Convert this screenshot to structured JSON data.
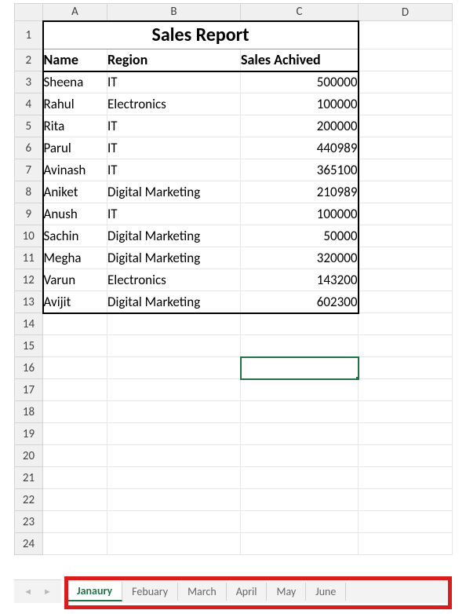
{
  "title": "Sales Report",
  "columns": [
    "A",
    "B",
    "C",
    "D"
  ],
  "headers": {
    "name": "Name",
    "region": "Region",
    "sales": "Sales Achived"
  },
  "rows": [
    {
      "name": "Sheena",
      "region": "IT",
      "sales": "500000"
    },
    {
      "name": "Rahul",
      "region": "Electronics",
      "sales": "100000"
    },
    {
      "name": "Rita",
      "region": "IT",
      "sales": "200000"
    },
    {
      "name": "Parul",
      "region": "IT",
      "sales": "440989"
    },
    {
      "name": "Avinash",
      "region": "IT",
      "sales": "365100"
    },
    {
      "name": "Aniket",
      "region": "Digital Marketing",
      "sales": "210989"
    },
    {
      "name": "Anush",
      "region": "IT",
      "sales": "100000"
    },
    {
      "name": "Sachin",
      "region": "Digital Marketing",
      "sales": "50000"
    },
    {
      "name": "Megha",
      "region": "Digital Marketing",
      "sales": "320000"
    },
    {
      "name": "Varun",
      "region": "Electronics",
      "sales": "143200"
    },
    {
      "name": "Avijit",
      "region": "Digital Marketing",
      "sales": "602300"
    }
  ],
  "selected_cell_row": 16,
  "selected_cell_col": "C",
  "total_visible_rows": 24,
  "tabs": [
    "Janaury",
    "Febuary",
    "March",
    "April",
    "May",
    "June"
  ],
  "active_tab": "Janaury"
}
